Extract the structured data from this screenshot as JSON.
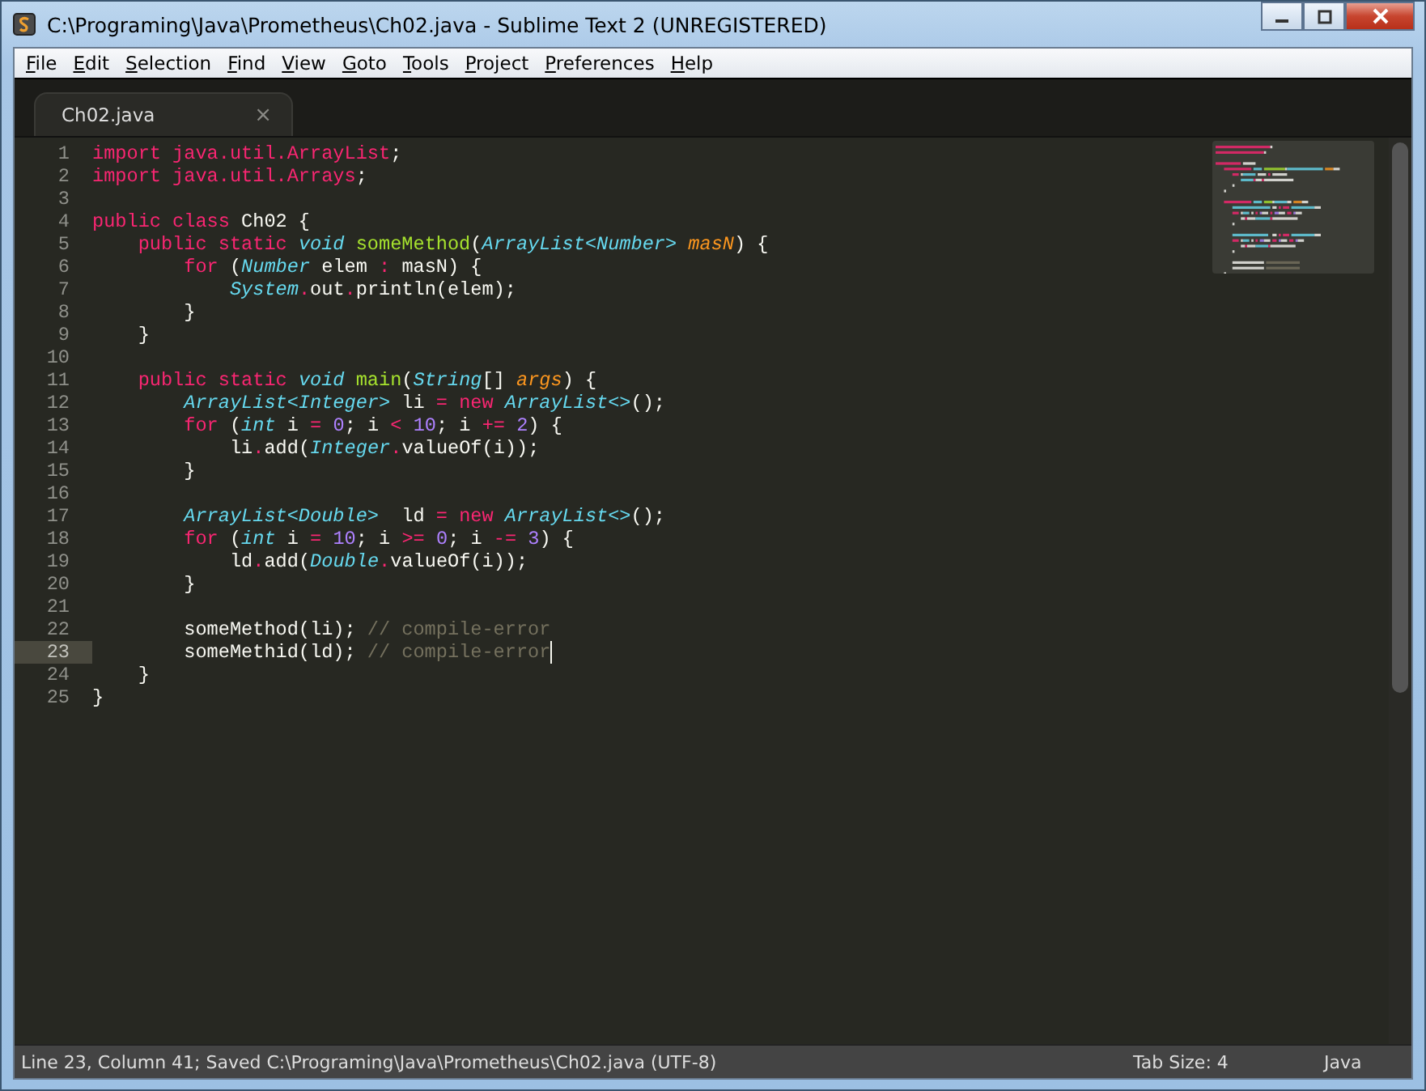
{
  "window": {
    "title": "C:\\Programing\\Java\\Prometheus\\Ch02.java - Sublime Text 2 (UNREGISTERED)"
  },
  "menu": [
    "File",
    "Edit",
    "Selection",
    "Find",
    "View",
    "Goto",
    "Tools",
    "Project",
    "Preferences",
    "Help"
  ],
  "tabs": [
    {
      "label": "Ch02.java",
      "close": "×",
      "selected": true
    }
  ],
  "lines": [
    {
      "number": "1",
      "current": false,
      "tokens": [
        {
          "text": "import java.util.ArrayList",
          "kind": "kw"
        },
        {
          "text": ";",
          "kind": "p"
        }
      ]
    },
    {
      "number": "2",
      "current": false,
      "tokens": [
        {
          "text": "import java.util.Arrays",
          "kind": "kw"
        },
        {
          "text": ";",
          "kind": "p"
        }
      ]
    },
    {
      "number": "3",
      "current": false
    },
    {
      "number": "4",
      "current": false,
      "tokens": [
        {
          "text": "public class",
          "kind": "kw"
        },
        {
          "text": " Ch02 {",
          "kind": "p"
        }
      ]
    },
    {
      "number": "5",
      "current": false,
      "tokens": [
        {
          "text": "    public static",
          "kind": "kw"
        },
        {
          "text": " void",
          "kind": "type"
        },
        {
          "text": " someMethod",
          "kind": "fn"
        },
        {
          "text": "(",
          "kind": "p"
        },
        {
          "text": "ArrayList<Number>",
          "kind": "type"
        },
        {
          "text": " masN",
          "kind": "param"
        },
        {
          "text": ") {",
          "kind": "p"
        }
      ]
    },
    {
      "number": "6",
      "current": false,
      "tokens": [
        {
          "text": "        for",
          "kind": "kw"
        },
        {
          "text": " (",
          "kind": "p"
        },
        {
          "text": "Number",
          "kind": "type"
        },
        {
          "text": " elem ",
          "kind": "p"
        },
        {
          "text": ":",
          "kind": "kw"
        },
        {
          "text": " masN) {",
          "kind": "p"
        }
      ]
    },
    {
      "number": "7",
      "current": false,
      "tokens": [
        {
          "text": "            System",
          "kind": "type"
        },
        {
          "text": ".",
          "kind": "kw"
        },
        {
          "text": "out",
          "kind": "p"
        },
        {
          "text": ".",
          "kind": "kw"
        },
        {
          "text": "println(elem);",
          "kind": "p"
        }
      ]
    },
    {
      "number": "8",
      "current": false,
      "tokens": [
        {
          "text": "        }",
          "kind": "p"
        }
      ]
    },
    {
      "number": "9",
      "current": false,
      "tokens": [
        {
          "text": "    }",
          "kind": "p"
        }
      ]
    },
    {
      "number": "10",
      "current": false
    },
    {
      "number": "11",
      "current": false,
      "tokens": [
        {
          "text": "    public static",
          "kind": "kw"
        },
        {
          "text": " void",
          "kind": "type"
        },
        {
          "text": " main",
          "kind": "fn"
        },
        {
          "text": "(",
          "kind": "p"
        },
        {
          "text": "String",
          "kind": "type"
        },
        {
          "text": "[]",
          "kind": "p"
        },
        {
          "text": " args",
          "kind": "param"
        },
        {
          "text": ") {",
          "kind": "p"
        }
      ]
    },
    {
      "number": "12",
      "current": false,
      "tokens": [
        {
          "text": "        ArrayList<Integer>",
          "kind": "type"
        },
        {
          "text": " li ",
          "kind": "p"
        },
        {
          "text": "=",
          "kind": "kw"
        },
        {
          "text": " new",
          "kind": "kw"
        },
        {
          "text": " ArrayList<>",
          "kind": "type"
        },
        {
          "text": "();",
          "kind": "p"
        }
      ]
    },
    {
      "number": "13",
      "current": false,
      "tokens": [
        {
          "text": "        for",
          "kind": "kw"
        },
        {
          "text": " (",
          "kind": "p"
        },
        {
          "text": "int",
          "kind": "type"
        },
        {
          "text": " i ",
          "kind": "p"
        },
        {
          "text": "=",
          "kind": "kw"
        },
        {
          "text": " 0",
          "kind": "num"
        },
        {
          "text": "; i ",
          "kind": "p"
        },
        {
          "text": "<",
          "kind": "kw"
        },
        {
          "text": " 10",
          "kind": "num"
        },
        {
          "text": "; i ",
          "kind": "p"
        },
        {
          "text": "+=",
          "kind": "kw"
        },
        {
          "text": " 2",
          "kind": "num"
        },
        {
          "text": ") {",
          "kind": "p"
        }
      ]
    },
    {
      "number": "14",
      "current": false,
      "tokens": [
        {
          "text": "            li",
          "kind": "p"
        },
        {
          "text": ".",
          "kind": "kw"
        },
        {
          "text": "add(",
          "kind": "p"
        },
        {
          "text": "Integer",
          "kind": "type"
        },
        {
          "text": ".",
          "kind": "kw"
        },
        {
          "text": "valueOf(i));",
          "kind": "p"
        }
      ]
    },
    {
      "number": "15",
      "current": false,
      "tokens": [
        {
          "text": "        }",
          "kind": "p"
        }
      ]
    },
    {
      "number": "16",
      "current": false
    },
    {
      "number": "17",
      "current": false,
      "tokens": [
        {
          "text": "        ArrayList<Double>",
          "kind": "type"
        },
        {
          "text": "  ld ",
          "kind": "p"
        },
        {
          "text": "=",
          "kind": "kw"
        },
        {
          "text": " new",
          "kind": "kw"
        },
        {
          "text": " ArrayList<>",
          "kind": "type"
        },
        {
          "text": "();",
          "kind": "p"
        }
      ]
    },
    {
      "number": "18",
      "current": false,
      "tokens": [
        {
          "text": "        for",
          "kind": "kw"
        },
        {
          "text": " (",
          "kind": "p"
        },
        {
          "text": "int",
          "kind": "type"
        },
        {
          "text": " i ",
          "kind": "p"
        },
        {
          "text": "=",
          "kind": "kw"
        },
        {
          "text": " 10",
          "kind": "num"
        },
        {
          "text": "; i ",
          "kind": "p"
        },
        {
          "text": ">=",
          "kind": "kw"
        },
        {
          "text": " 0",
          "kind": "num"
        },
        {
          "text": "; i ",
          "kind": "p"
        },
        {
          "text": "-=",
          "kind": "kw"
        },
        {
          "text": " 3",
          "kind": "num"
        },
        {
          "text": ") {",
          "kind": "p"
        }
      ]
    },
    {
      "number": "19",
      "current": false,
      "tokens": [
        {
          "text": "            ld",
          "kind": "p"
        },
        {
          "text": ".",
          "kind": "kw"
        },
        {
          "text": "add(",
          "kind": "p"
        },
        {
          "text": "Double",
          "kind": "type"
        },
        {
          "text": ".",
          "kind": "kw"
        },
        {
          "text": "valueOf(i));",
          "kind": "p"
        }
      ]
    },
    {
      "number": "20",
      "current": false,
      "tokens": [
        {
          "text": "        }",
          "kind": "p"
        }
      ]
    },
    {
      "number": "21",
      "current": false
    },
    {
      "number": "22",
      "current": false,
      "tokens": [
        {
          "text": "        someMethod(li);",
          "kind": "p"
        },
        {
          "text": " // compile-error",
          "kind": "comment"
        }
      ]
    },
    {
      "number": "23",
      "current": true,
      "tokens": [
        {
          "text": "        someMethid(ld);",
          "kind": "p"
        },
        {
          "text": " // compile-error",
          "kind": "comment"
        }
      ]
    },
    {
      "number": "24",
      "current": false,
      "tokens": [
        {
          "text": "    }",
          "kind": "p"
        }
      ]
    },
    {
      "number": "25",
      "current": false,
      "tokens": [
        {
          "text": "}",
          "kind": "p"
        }
      ]
    }
  ],
  "status_bar": {
    "message": "Line 23, Column 41; Saved C:\\Programing\\Java\\Prometheus\\Ch02.java (UTF-8)",
    "tab_size": "Tab Size: 4",
    "syntax": "Java"
  }
}
